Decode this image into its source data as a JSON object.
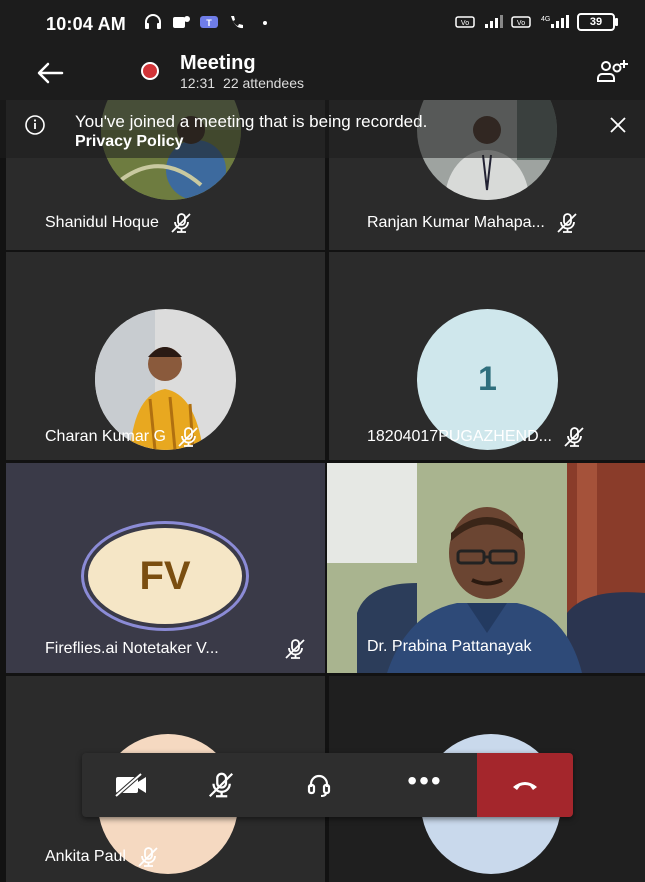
{
  "status_bar": {
    "time": "10:04 AM",
    "battery": "39",
    "network_label": "4G"
  },
  "header": {
    "title": "Meeting",
    "duration": "12:31",
    "attendees": "22 attendees",
    "recording_color": "#d13438"
  },
  "banner": {
    "message": "You've joined a meeting that is being recorded.",
    "link": "Privacy Policy"
  },
  "participants": [
    {
      "name": "Shanidul Hoque",
      "muted": true
    },
    {
      "name": "Ranjan Kumar Mahapa...",
      "muted": true
    },
    {
      "name": "Charan Kumar G",
      "muted": true
    },
    {
      "name": "18204017PUGAZHEND...",
      "muted": true,
      "avatar_text": "1"
    },
    {
      "name": "Fireflies.ai Notetaker V...",
      "muted": true,
      "avatar_text": "FV"
    },
    {
      "name": "Dr. Prabina Pattanayak",
      "muted": false
    },
    {
      "name": "Ankita Paul",
      "muted": true
    },
    {
      "name": "",
      "muted": false
    }
  ],
  "controls": {
    "camera": "camera-off",
    "mic": "mic-off",
    "audio": "headset",
    "more": "•••",
    "end_color": "#a4262c"
  }
}
